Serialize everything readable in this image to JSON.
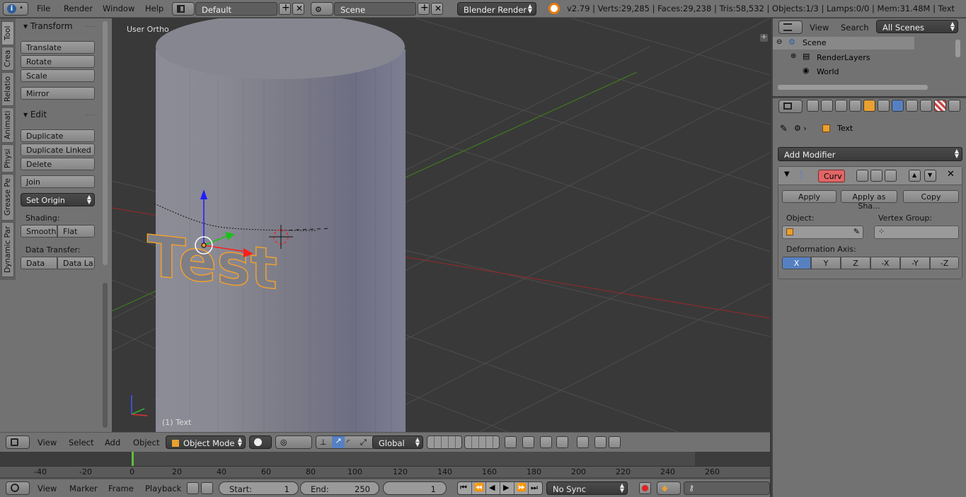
{
  "topbar": {
    "menus": [
      "File",
      "Render",
      "Window",
      "Help"
    ],
    "screen_layout": "Default",
    "scene": "Scene",
    "render_engine": "Blender Render",
    "stats": "v2.79 | Verts:29,285 | Faces:29,238 | Tris:58,532 | Objects:1/3 | Lamps:0/0 | Mem:31.48M | Text"
  },
  "toolshelf": {
    "tabs": [
      "Tool",
      "Crea",
      "Relatio",
      "Animati",
      "Physi",
      "Grease Pe",
      "Dynamic Par"
    ],
    "transform_title": "Transform",
    "translate": "Translate",
    "rotate": "Rotate",
    "scale": "Scale",
    "mirror": "Mirror",
    "edit_title": "Edit",
    "duplicate": "Duplicate",
    "duplicate_linked": "Duplicate Linked",
    "delete": "Delete",
    "join": "Join",
    "set_origin": "Set Origin",
    "shading_label": "Shading:",
    "smooth": "Smooth",
    "flat": "Flat",
    "data_transfer_label": "Data Transfer:",
    "data": "Data",
    "data_la": "Data La"
  },
  "viewport": {
    "view_label": "User Ortho",
    "object_label": "(1) Text",
    "text_object": "Test"
  },
  "viewport_header": {
    "menus": [
      "View",
      "Select",
      "Add",
      "Object"
    ],
    "mode": "Object Mode",
    "orientation": "Global"
  },
  "timeline": {
    "ticks": [
      "-40",
      "-20",
      "0",
      "20",
      "40",
      "60",
      "80",
      "100",
      "120",
      "140",
      "160",
      "180",
      "200",
      "220",
      "240",
      "260"
    ],
    "menus": [
      "View",
      "Marker",
      "Frame",
      "Playback"
    ],
    "start_label": "Start:",
    "start_value": "1",
    "end_label": "End:",
    "end_value": "250",
    "current_frame": "1",
    "sync": "No Sync"
  },
  "outliner": {
    "menus": [
      "View",
      "Search"
    ],
    "filter": "All Scenes",
    "items": [
      "Scene",
      "RenderLayers",
      "World"
    ]
  },
  "properties": {
    "breadcrumb_object": "Text",
    "add_modifier": "Add Modifier",
    "modifier_name": "Curv",
    "apply": "Apply",
    "apply_as_shape": "Apply as Sha...",
    "copy": "Copy",
    "object_label": "Object:",
    "vertex_group_label": "Vertex Group:",
    "deformation_axis_label": "Deformation Axis:",
    "axes": [
      "X",
      "Y",
      "Z",
      "-X",
      "-Y",
      "-Z"
    ],
    "active_axis": "X"
  },
  "colors": {
    "accent": "#5680c2",
    "modifier_name_bg": "#e06666",
    "selected_outline": "#f0a030"
  }
}
